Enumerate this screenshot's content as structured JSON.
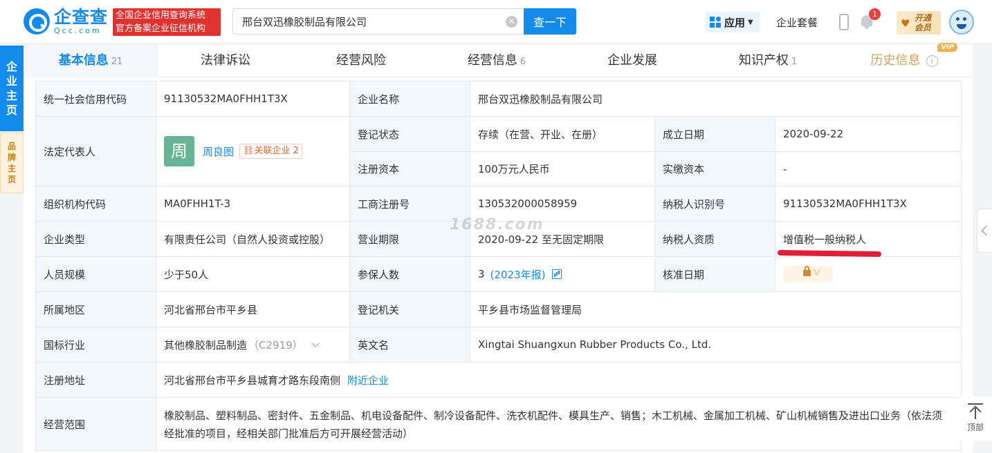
{
  "header": {
    "logo_cn": "企查查",
    "logo_en": "Qcc.com",
    "slogan_line1": "全国企业信用查询系统",
    "slogan_line2": "官方备案企业征信机构",
    "search_value": "邢台双迅橡胶制品有限公司",
    "search_button": "查一下",
    "apps_label": "应用",
    "package_link": "企业套餐",
    "notification_count": "1",
    "vip_label": "开通会员"
  },
  "side": {
    "main_tab": [
      "企",
      "业",
      "主",
      "页"
    ],
    "brand_tab": [
      "品",
      "牌",
      "主",
      "页"
    ]
  },
  "tabs": [
    {
      "label": "基本信息",
      "count": "21"
    },
    {
      "label": "法律诉讼",
      "count": ""
    },
    {
      "label": "经营风险",
      "count": ""
    },
    {
      "label": "经营信息",
      "count": "6"
    },
    {
      "label": "企业发展",
      "count": ""
    },
    {
      "label": "知识产权",
      "count": "1"
    },
    {
      "label": "历史信息",
      "count": "",
      "tag": "VIP",
      "info": "i"
    }
  ],
  "info": {
    "credit_code_label": "统一社会信用代码",
    "credit_code": "91130532MA0FHH1T3X",
    "company_name_label": "企业名称",
    "company_name": "邢台双迅橡胶制品有限公司",
    "legal_rep_label": "法定代表人",
    "legal_rep_avatar": "周",
    "legal_rep_name": "周良图",
    "related_label": "关联企业",
    "related_count": "2",
    "status_label": "登记状态",
    "status": "存续（在营、开业、在册）",
    "founded_label": "成立日期",
    "founded": "2020-09-22",
    "reg_capital_label": "注册资本",
    "reg_capital": "100万元人民币",
    "paid_capital_label": "实缴资本",
    "paid_capital": "-",
    "org_code_label": "组织机构代码",
    "org_code": "MA0FHH1T-3",
    "biz_reg_no_label": "工商注册号",
    "biz_reg_no": "130532000058959",
    "taxpayer_id_label": "纳税人识别号",
    "taxpayer_id": "91130532MA0FHH1T3X",
    "company_type_label": "企业类型",
    "company_type": "有限责任公司（自然人投资或控股）",
    "biz_term_label": "营业期限",
    "biz_term": "2020-09-22 至无固定期限",
    "taxpayer_qual_label": "纳税人资质",
    "taxpayer_qual": "增值税一般纳税人",
    "staff_size_label": "人员规模",
    "staff_size": "少于50人",
    "insured_label": "参保人数",
    "insured_count": "3",
    "insured_report": "(2023年报)",
    "approval_date_label": "核准日期",
    "region_label": "所属地区",
    "region": "河北省邢台市平乡县",
    "reg_authority_label": "登记机关",
    "reg_authority": "平乡县市场监督管理局",
    "industry_label": "国标行业",
    "industry": "其他橡胶制品制造",
    "industry_code": "（C2919）",
    "english_name_label": "英文名",
    "english_name": "Xingtai Shuangxun Rubber Products Co., Ltd.",
    "address_label": "注册地址",
    "address": "河北省邢台市平乡县城育才路东段南侧",
    "nearby_link": "附近企业",
    "scope_label": "经营范围",
    "scope": "橡胶制品、塑料制品、密封件、五金制品、机电设备配件、制冷设备配件、洗衣机配件、模具生产、销售；木工机械、金属加工机械、矿山机械销售及进出口业务（依法须经批准的项目，经相关部门批准后方可开展经营活动）"
  },
  "watermark": "1688.com",
  "back_to_top": "顶部",
  "colors": {
    "brand_blue": "#128bed",
    "slogan_red": "#e0322f",
    "label_bg": "#f2f7fc",
    "highlight_red": "#e01e37"
  }
}
